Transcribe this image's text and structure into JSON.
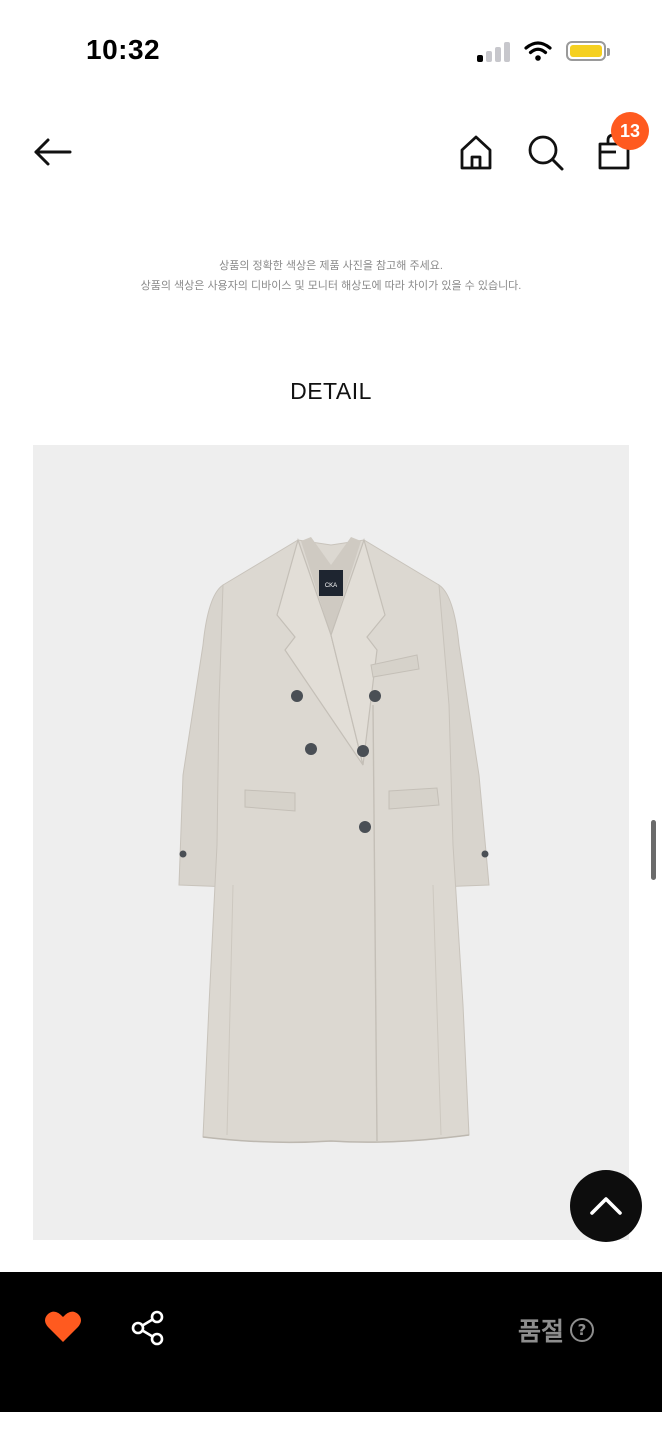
{
  "status_bar": {
    "time": "10:32"
  },
  "nav": {
    "cart_count": "13"
  },
  "notice": {
    "line1": "상품의 정확한 색상은 제품 사진을 참고해 주세요.",
    "line2": "상품의 색상은 사용자의 디바이스 및 모니터 해상도에 따라 차이가 있을 수 있습니다."
  },
  "section": {
    "title": "DETAIL"
  },
  "product": {
    "label_text": "CKA",
    "image_background": "#eeeeee",
    "coat_color": "#dcd8d1"
  },
  "bottom_bar": {
    "sold_out_label": "품절",
    "help_label": "?",
    "like_color": "#ff5a1f"
  }
}
